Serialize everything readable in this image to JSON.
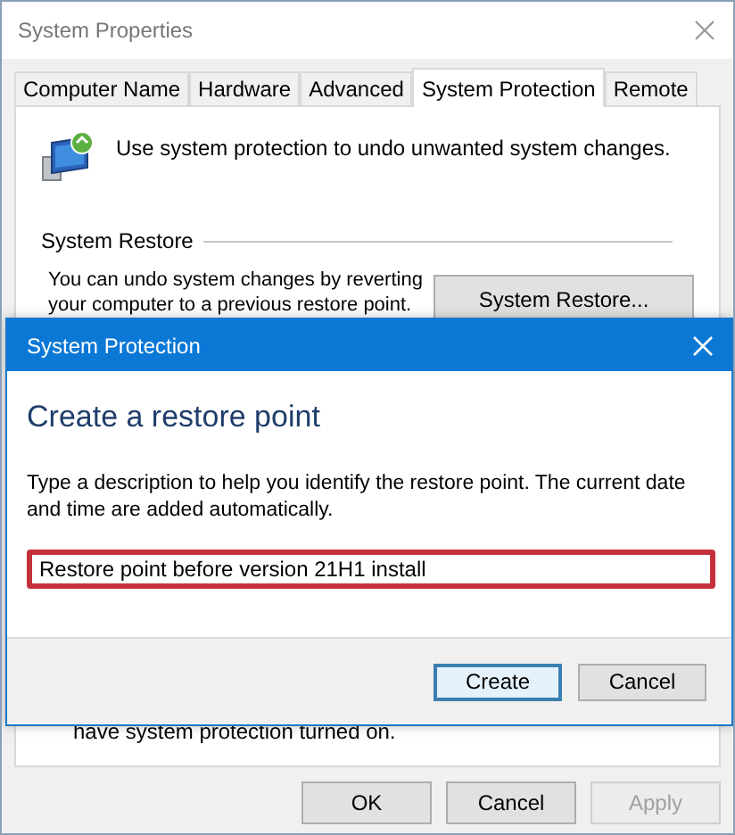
{
  "window": {
    "title": "System Properties"
  },
  "tabs": [
    {
      "label": "Computer Name",
      "selected": false
    },
    {
      "label": "Hardware",
      "selected": false
    },
    {
      "label": "Advanced",
      "selected": false
    },
    {
      "label": "System Protection",
      "selected": true
    },
    {
      "label": "Remote",
      "selected": false
    }
  ],
  "intro": "Use system protection to undo unwanted system changes.",
  "system_restore": {
    "group_label": "System Restore",
    "description": "You can undo system changes by reverting your computer to a previous restore point.",
    "button": "System Restore..."
  },
  "covered_note": "have system protection turned on.",
  "buttons": [
    {
      "label": "OK",
      "disabled": false
    },
    {
      "label": "Cancel",
      "disabled": false
    },
    {
      "label": "Apply",
      "disabled": true
    }
  ],
  "dialog": {
    "title": "System Protection",
    "heading": "Create a restore point",
    "description": "Type a description to help you identify the restore point. The current date and time are added automatically.",
    "value": "Restore point before version 21H1 install",
    "buttons": [
      {
        "label": "Create",
        "default": true
      },
      {
        "label": "Cancel",
        "default": false
      }
    ]
  }
}
